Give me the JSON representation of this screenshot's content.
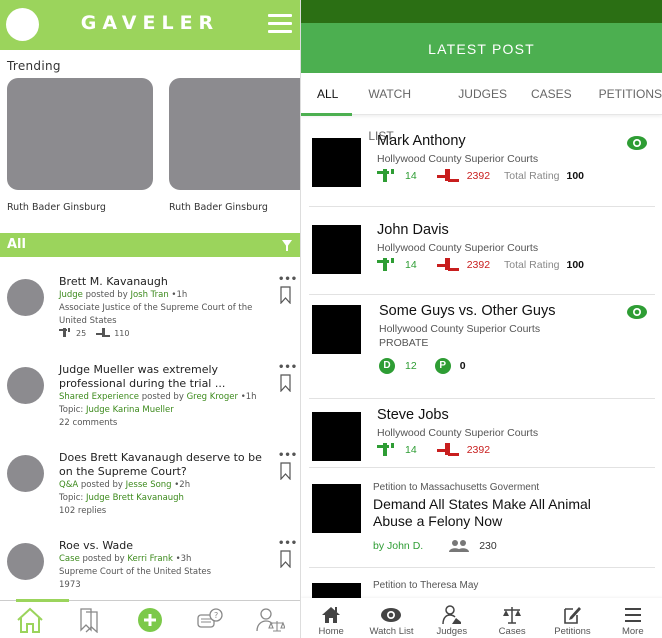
{
  "left": {
    "app_title": "GAVELER",
    "trending_title": "Trending",
    "trending": [
      {
        "name": "Ruth Bader Ginsburg"
      },
      {
        "name": "Ruth Bader Ginsburg"
      }
    ],
    "filter_label": "All",
    "feed": [
      {
        "title": "Brett M. Kavanaugh",
        "category": "Judge",
        "posted_by_label": "posted by",
        "author": "Josh Tran",
        "time": "1h",
        "sub1": "Associate Justice of the Supreme Court of the United States",
        "gavel_count": "25",
        "stand_count": "110"
      },
      {
        "title": "Judge Mueller was extremely professional during the trial ...",
        "category": "Shared Experience",
        "posted_by_label": "posted by",
        "author": "Greg Kroger",
        "time": "1h",
        "topic_label": "Topic:",
        "topic": "Judge Karina Mueller",
        "count_text": "22 comments"
      },
      {
        "title": "Does Brett Kavanaugh deserve to be on the Supreme Court?",
        "category": "Q&A",
        "posted_by_label": "posted by",
        "author": "Jesse Song",
        "time": "2h",
        "topic_label": "Topic:",
        "topic": "Judge Brett Kavanaugh",
        "count_text": "102 replies"
      },
      {
        "title": "Roe vs. Wade",
        "category": "Case",
        "posted_by_label": "posted by",
        "author": "Kerri Frank",
        "time": "3h",
        "sub1": "Supreme Court of the United States",
        "sub2": "1973"
      }
    ],
    "tabbar": [
      "home-icon",
      "bookmarks-icon",
      "add-icon",
      "qa-icon",
      "judge-icon"
    ]
  },
  "right": {
    "header_title": "LATEST POST",
    "tabs": [
      "ALL",
      "WATCH LIST",
      "JUDGES",
      "CASES",
      "PETITIONS"
    ],
    "active_tab": "ALL",
    "items": [
      {
        "name": "Mark Anthony",
        "court": "Hollywood County Superior Courts",
        "up": "14",
        "down": "2392",
        "rating_label": "Total Rating",
        "rating": "100",
        "watched": true
      },
      {
        "name": "John Davis",
        "court": "Hollywood County Superior Courts",
        "up": "14",
        "down": "2392",
        "rating_label": "Total Rating",
        "rating": "100",
        "watched": false
      },
      {
        "name": "Some Guys vs. Other Guys",
        "court": "Hollywood County Superior Courts",
        "type": "PROBATE",
        "d_label": "D",
        "d_count": "12",
        "p_label": "P",
        "p_count": "0",
        "watched": true
      },
      {
        "name": "Steve Jobs",
        "court": "Hollywood County Superior Courts",
        "up": "14",
        "down": "2392",
        "watched": false
      },
      {
        "petition_to": "Petition to Massachusetts Goverment",
        "title": "Demand All States Make All Animal Abuse a Felony Now",
        "author": "by John D.",
        "supporters": "230"
      },
      {
        "petition_to": "Petition to Theresa May"
      }
    ],
    "bottom_nav": [
      {
        "label": "Home",
        "icon": "home-icon"
      },
      {
        "label": "Watch List",
        "icon": "eye-icon"
      },
      {
        "label": "Judges",
        "icon": "judge-icon"
      },
      {
        "label": "Cases",
        "icon": "scales-icon"
      },
      {
        "label": "Petitions",
        "icon": "petition-icon"
      },
      {
        "label": "More",
        "icon": "menu-icon"
      }
    ],
    "colors": {
      "primary": "#4caf50",
      "status_bar": "#2b6f14",
      "positive": "#2e9d34",
      "negative": "#c81e1e"
    }
  },
  "colors": {
    "left_accent": "#9bd45c",
    "link_green": "#3c8a1c"
  }
}
